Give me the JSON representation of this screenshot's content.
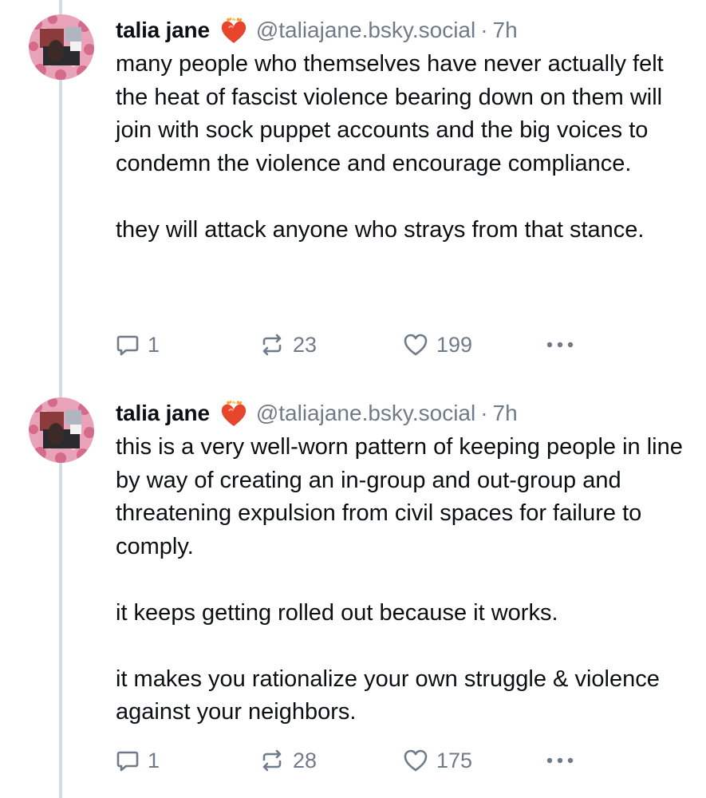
{
  "posts": [
    {
      "author": {
        "display_name": "talia jane",
        "handle": "@taliajane.bsky.social",
        "badge_icon": "heart-on-fire-icon"
      },
      "separator": "·",
      "time": "7h",
      "paragraphs": [
        "many people who themselves have never actually felt the heat of fascist violence bearing down on them will join with sock puppet accounts and the big voices to condemn the violence and encourage compliance.",
        "they will attack anyone who strays from that stance."
      ],
      "stats": {
        "replies": "1",
        "reposts": "23",
        "likes": "199"
      }
    },
    {
      "author": {
        "display_name": "talia jane",
        "handle": "@taliajane.bsky.social",
        "badge_icon": "heart-on-fire-icon"
      },
      "separator": "·",
      "time": "7h",
      "paragraphs": [
        "this is a very well-worn pattern of keeping people in line by way of creating an in-group and out-group and threatening expulsion from civil spaces for failure to comply.",
        "it keeps getting rolled out because it works.",
        "it makes you rationalize your own struggle & violence against your neighbors."
      ],
      "stats": {
        "replies": "1",
        "reposts": "28",
        "likes": "175"
      }
    }
  ],
  "colors": {
    "text": "#0b0f14",
    "muted": "#6f7b88",
    "thread_line": "#d4dbe2",
    "heart_fire": "#e8462c"
  }
}
